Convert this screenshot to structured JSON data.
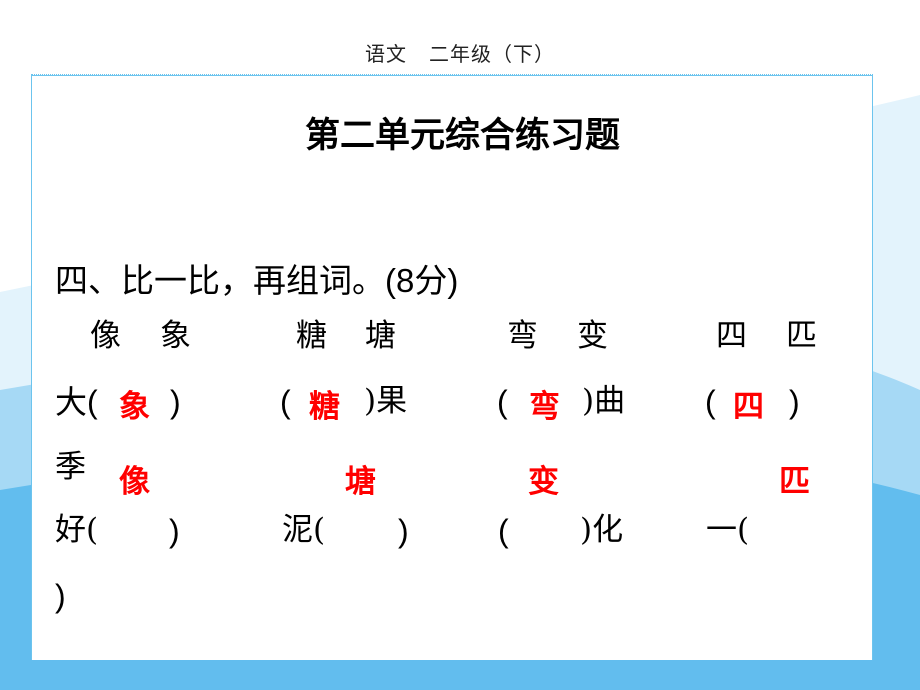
{
  "header": {
    "subject": "语文",
    "grade": "二年级（下）"
  },
  "title": "第二单元综合练习题",
  "question": {
    "label": "四、比一比，再组词。",
    "score": "(8分)"
  },
  "pairs": [
    {
      "a": "像",
      "b": "象"
    },
    {
      "a": "糖",
      "b": "塘"
    },
    {
      "a": "弯",
      "b": "变"
    },
    {
      "a": "四",
      "b": "匹"
    }
  ],
  "row1": [
    {
      "prefix": "大(",
      "suffix": ")",
      "answer": "象"
    },
    {
      "prefix": "(",
      "suffix": ")果",
      "answer": "糖"
    },
    {
      "prefix": "(",
      "suffix": ")曲",
      "answer": "弯"
    },
    {
      "prefix": "(",
      "suffix": ")",
      "answer": "四"
    }
  ],
  "row2_start": "季",
  "row2_answers": [
    "像",
    "塘",
    "变",
    "匹"
  ],
  "row3": [
    {
      "prefix": "好(",
      "suffix": ")"
    },
    {
      "prefix": "泥(",
      "suffix": ")"
    },
    {
      "prefix": "(",
      "suffix": ")化"
    },
    {
      "prefix": "一(",
      "suffix": ""
    }
  ],
  "row4": ")",
  "colors": {
    "answer": "#ff0000",
    "frame": "#6cc4ee",
    "wave_light": "#dff1fb",
    "wave_mid": "#9fd6f4",
    "wave_dark": "#5ab8ec"
  }
}
